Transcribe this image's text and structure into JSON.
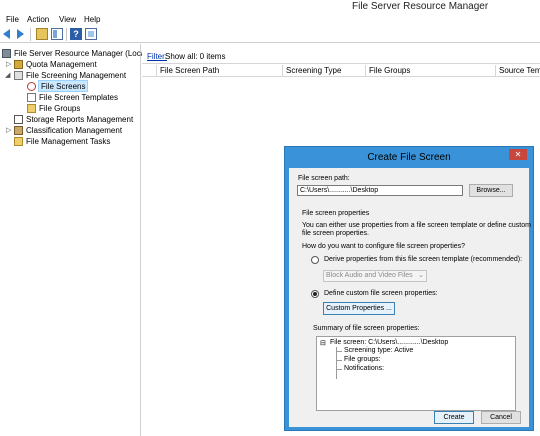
{
  "window": {
    "title": "File Server Resource Manager"
  },
  "menu": [
    "File",
    "Action",
    "View",
    "Help"
  ],
  "tree": {
    "items": [
      {
        "label": "File Server Resource Manager (Local)"
      },
      {
        "label": "Quota Management"
      },
      {
        "label": "File Screening Management"
      },
      {
        "label": "File Screens"
      },
      {
        "label": "File Screen Templates"
      },
      {
        "label": "File Groups"
      },
      {
        "label": "Storage Reports Management"
      },
      {
        "label": "Classification Management"
      },
      {
        "label": "File Management Tasks"
      }
    ]
  },
  "content": {
    "filter_link": "Filter:",
    "filter_text": "Show all: 0 items",
    "columns": [
      "File Screen Path",
      "Screening Type",
      "File Groups",
      "Source Temp"
    ]
  },
  "dialog": {
    "title": "Create File Screen",
    "path_label": "File screen path:",
    "path_value": "C:\\Users\\...........\\Desktop",
    "browse_label": "Browse...",
    "props_heading": "File screen properties",
    "props_desc_1": "You can either use properties from a file screen template or define custom",
    "props_desc_2": "file screen properties.",
    "config_question": "How do you want to configure file screen properties?",
    "option_template": "Derive properties from this file screen template (recommended):",
    "template_selected": "Block Audio and Video Files",
    "option_custom": "Define custom file screen properties:",
    "custom_button": "Custom Properties ...",
    "summary_label": "Summary of file screen properties:",
    "summary": {
      "root": "File screen: C:\\Users\\............\\Desktop",
      "screening_type": "Screening type: Active",
      "file_groups": "File groups:",
      "notifications": "Notifications:"
    },
    "create_label": "Create",
    "cancel_label": "Cancel",
    "close_glyph": "✕"
  }
}
